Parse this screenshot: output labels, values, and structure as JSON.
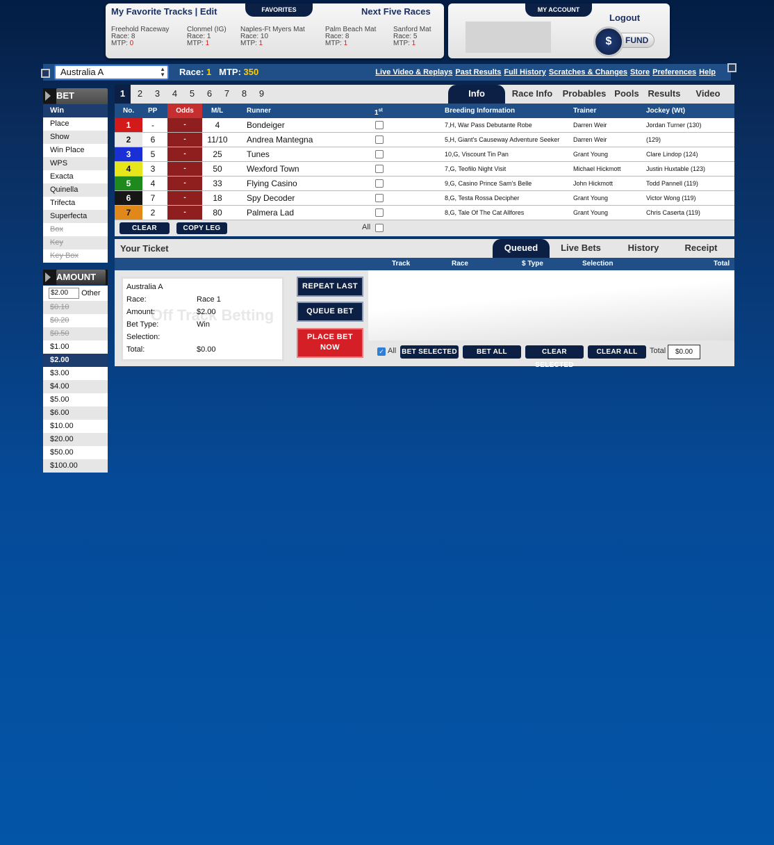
{
  "favorites": {
    "title": "My Favorite Tracks | Edit",
    "tab_label": "FAVORITES",
    "next_title": "Next Five Races",
    "races": [
      {
        "track": "Freehold Raceway",
        "race": "Race: 8",
        "mtp_label": "MTP:",
        "mtp": "0"
      },
      {
        "track": "Clonmel (IG)",
        "race": "Race: 1",
        "mtp_label": "MTP:",
        "mtp": "1"
      },
      {
        "track": "Naples-Ft Myers Mat",
        "race": "Race: 10",
        "mtp_label": "MTP:",
        "mtp": "1"
      },
      {
        "track": "Palm Beach Mat",
        "race": "Race: 8",
        "mtp_label": "MTP:",
        "mtp": "1"
      },
      {
        "track": "Sanford Mat",
        "race": "Race: 5",
        "mtp_label": "MTP:",
        "mtp": "1"
      }
    ]
  },
  "account": {
    "tab_label": "MY ACCOUNT",
    "logout": "Logout",
    "fund_symbol": "$",
    "fund_label": "FUND"
  },
  "race_bar": {
    "track": "Australia A",
    "race_label": "Race:",
    "race_value": "1",
    "mtp_label": "MTP:",
    "mtp_value": "350",
    "links": [
      "Live Video & Replays",
      "Past Results",
      "Full History",
      "Scratches & Changes",
      "Store",
      "Preferences",
      "Help"
    ]
  },
  "bet_type": {
    "header": "BET TYPE",
    "items": [
      {
        "label": "Win",
        "state": "selected"
      },
      {
        "label": "Place",
        "state": "normal"
      },
      {
        "label": "Show",
        "state": "normal"
      },
      {
        "label": "Win Place",
        "state": "normal"
      },
      {
        "label": "WPS",
        "state": "normal"
      },
      {
        "label": "Exacta",
        "state": "normal"
      },
      {
        "label": "Quinella",
        "state": "normal"
      },
      {
        "label": "Trifecta",
        "state": "normal"
      },
      {
        "label": "Superfecta",
        "state": "normal"
      },
      {
        "label": "Box",
        "state": "disabled"
      },
      {
        "label": "Key",
        "state": "disabled"
      },
      {
        "label": "Key Box",
        "state": "disabled"
      }
    ]
  },
  "amount": {
    "header": "AMOUNT",
    "other_value": "$2.00",
    "other_label": "Other",
    "items": [
      {
        "label": "$0.10",
        "state": "disabled"
      },
      {
        "label": "$0.20",
        "state": "disabled"
      },
      {
        "label": "$0.50",
        "state": "disabled"
      },
      {
        "label": "$1.00",
        "state": "normal"
      },
      {
        "label": "$2.00",
        "state": "selected"
      },
      {
        "label": "$3.00",
        "state": "normal"
      },
      {
        "label": "$4.00",
        "state": "normal"
      },
      {
        "label": "$5.00",
        "state": "normal"
      },
      {
        "label": "$6.00",
        "state": "normal"
      },
      {
        "label": "$10.00",
        "state": "normal"
      },
      {
        "label": "$20.00",
        "state": "normal"
      },
      {
        "label": "$50.00",
        "state": "normal"
      },
      {
        "label": "$100.00",
        "state": "normal"
      }
    ]
  },
  "races": [
    "1",
    "2",
    "3",
    "4",
    "5",
    "6",
    "7",
    "8",
    "9"
  ],
  "info_tabs": [
    "Info",
    "Race Info",
    "Probables",
    "Pools",
    "Results",
    "Video"
  ],
  "table": {
    "headers": {
      "no": "No.",
      "pp": "PP",
      "odds": "Odds",
      "ml": "M/L",
      "runner": "Runner",
      "first": "1st",
      "breeding": "Breeding Information",
      "trainer": "Trainer",
      "jockey": "Jockey (Wt)"
    },
    "rows": [
      {
        "no": "1",
        "color": "#d21a1a",
        "text": "#ffffff",
        "pp": "-",
        "odds": "-",
        "ml": "4",
        "runner": "Bondeiger",
        "breeding": "7,H, War Pass Debutante Robe",
        "trainer": "Darren Weir",
        "jockey": "Jordan Turner (130)"
      },
      {
        "no": "2",
        "color": "#e6e6e6",
        "text": "#111111",
        "pp": "6",
        "odds": "-",
        "ml": "11/10",
        "runner": "Andrea Mantegna",
        "breeding": "5,H, Giant's Causeway Adventure Seeker",
        "trainer": "Darren Weir",
        "jockey": "(129)"
      },
      {
        "no": "3",
        "color": "#1a2fd6",
        "text": "#ffffff",
        "pp": "5",
        "odds": "-",
        "ml": "25",
        "runner": "Tunes",
        "breeding": "10,G, Viscount Tin Pan",
        "trainer": "Grant Young",
        "jockey": "Clare Lindop (124)"
      },
      {
        "no": "4",
        "color": "#e6e61a",
        "text": "#111111",
        "pp": "3",
        "odds": "-",
        "ml": "50",
        "runner": "Wexford Town",
        "breeding": "7,G, Teofilo Night Visit",
        "trainer": "Michael Hickmott",
        "jockey": "Justin Huxtable (123)"
      },
      {
        "no": "5",
        "color": "#1e8a1e",
        "text": "#ffffff",
        "pp": "4",
        "odds": "-",
        "ml": "33",
        "runner": "Flying Casino",
        "breeding": "9,G, Casino Prince Sam's Belle",
        "trainer": "John Hickmott",
        "jockey": "Todd Pannell (119)"
      },
      {
        "no": "6",
        "color": "#161616",
        "text": "#ffffff",
        "pp": "7",
        "odds": "-",
        "ml": "18",
        "runner": "Spy Decoder",
        "breeding": "8,G, Testa Rossa Decipher",
        "trainer": "Grant Young",
        "jockey": "Victor Wong (119)"
      },
      {
        "no": "7",
        "color": "#e0891a",
        "text": "#111111",
        "pp": "2",
        "odds": "-",
        "ml": "80",
        "runner": "Palmera Lad",
        "breeding": "8,G, Tale Of The Cat Allfores",
        "trainer": "Grant Young",
        "jockey": "Chris Caserta (119)"
      }
    ],
    "clear_label": "CLEAR",
    "copy_leg_label": "COPY LEG",
    "all_label": "All"
  },
  "ticket": {
    "title": "Your Ticket",
    "tabs": [
      "Queued",
      "Live Bets",
      "History",
      "Receipt"
    ],
    "headers": {
      "track": "Track",
      "race": "Race",
      "type": "$ Type",
      "selection": "Selection",
      "total": "Total"
    },
    "slip": {
      "track": "Australia A",
      "race_label": "Race:",
      "race_value": "Race 1",
      "amount_label": "Amount:",
      "amount_value": "$2.00",
      "bet_type_label": "Bet Type:",
      "bet_type_value": "Win",
      "selection_label": "Selection:",
      "selection_value": "",
      "total_label": "Total:",
      "total_value": "$0.00",
      "watermark": "Off Track Betting"
    },
    "repeat_last": "REPEAT LAST",
    "queue_bet": "QUEUE BET",
    "place_bet": "PLACE BET NOW",
    "footer": {
      "all_label": "All",
      "bet_selected": "BET SELECTED",
      "bet_all": "BET ALL",
      "clear_selected": "CLEAR SELECTED",
      "clear_all": "CLEAR ALL",
      "total_label": "Total",
      "total_value": "$0.00"
    }
  }
}
